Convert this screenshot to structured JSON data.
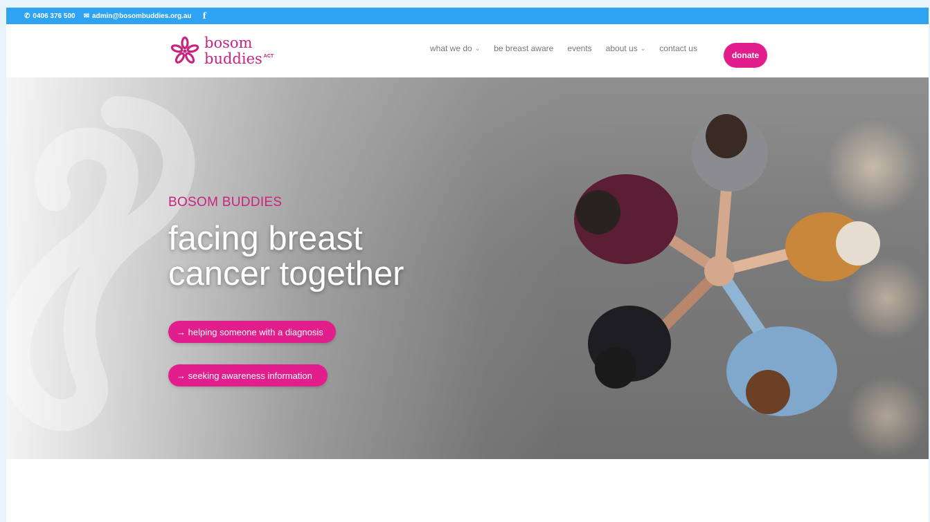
{
  "topbar": {
    "phone": "0406 376 500",
    "email": "admin@bosombuddies.org.au",
    "facebook": "f"
  },
  "logo": {
    "line1": "bosom",
    "line2": "buddies",
    "region": "ACT"
  },
  "nav": {
    "items": [
      {
        "label": "what we do",
        "has_dropdown": true
      },
      {
        "label": "be breast aware",
        "has_dropdown": false
      },
      {
        "label": "events",
        "has_dropdown": false
      },
      {
        "label": "about us",
        "has_dropdown": true
      },
      {
        "label": "contact us",
        "has_dropdown": false
      }
    ],
    "donate_label": "donate"
  },
  "hero": {
    "eyebrow": "BOSOM BUDDIES",
    "headline_line1": "facing breast",
    "headline_line2": "cancer together",
    "cta_primary": "→ helping someone with a diagnosis",
    "cta_secondary": "→ seeking awareness information"
  },
  "colors": {
    "topbar": "#2ea3f2",
    "brand_pink": "#e21e8c",
    "logo_pink": "#c8247f"
  }
}
